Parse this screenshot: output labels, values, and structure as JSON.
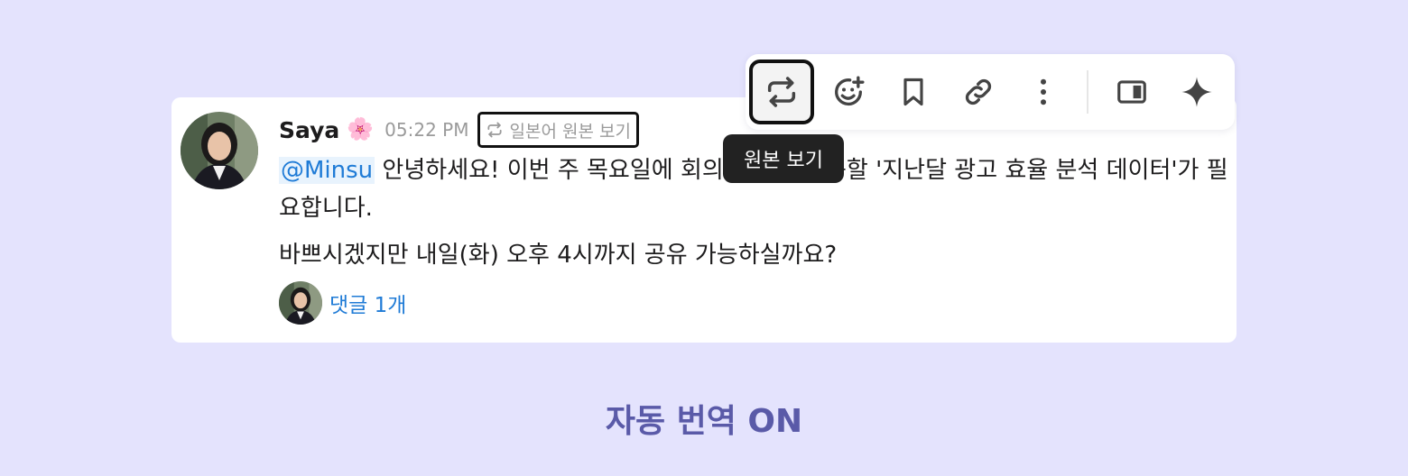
{
  "message": {
    "author": "Saya",
    "author_emoji": "🌸",
    "time": "05:22 PM",
    "view_original_label": "일본어 원본 보기",
    "mention": "@Minsu",
    "line1_text": " 안녕하세요! 이번 주 목요일에 회의 자료에 활용할 '지난달 광고 효율 분석 데이터'가 필요합니다.",
    "line2_text": "바쁘시겠지만 내일(화) 오후 4시까지 공유 가능하실까요?",
    "reply_count_label": "댓글 1개"
  },
  "toolbar": {
    "buttons": [
      {
        "icon": "translate-repeat-icon",
        "active": true
      },
      {
        "icon": "add-reaction-icon"
      },
      {
        "icon": "bookmark-icon"
      },
      {
        "icon": "link-icon"
      },
      {
        "icon": "more-vertical-icon"
      },
      {
        "icon": "side-panel-icon"
      },
      {
        "icon": "ai-sparkle-icon"
      }
    ],
    "tooltip": "원본 보기"
  },
  "caption": "자동 번역 ON",
  "colors": {
    "background": "#e4e3fd",
    "link": "#1f7bd6",
    "caption": "#5a5aa8"
  }
}
